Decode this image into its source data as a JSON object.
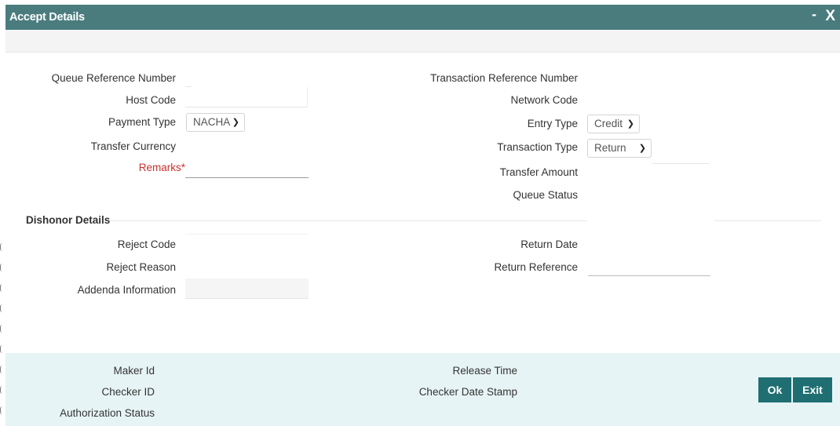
{
  "window": {
    "title": "Accept Details",
    "minimize": "-",
    "close": "X"
  },
  "form": {
    "queue_reference_number": {
      "label": "Queue Reference Number",
      "value": ""
    },
    "host_code": {
      "label": "Host Code",
      "value": ""
    },
    "payment_type": {
      "label": "Payment Type",
      "value": "NACHA"
    },
    "transfer_currency": {
      "label": "Transfer Currency",
      "value": ""
    },
    "remarks": {
      "label": "Remarks",
      "required_mark": "*",
      "value": ""
    },
    "transaction_reference_number": {
      "label": "Transaction Reference Number",
      "value": ""
    },
    "network_code": {
      "label": "Network Code",
      "value": ""
    },
    "entry_type": {
      "label": "Entry Type",
      "value": "Credit"
    },
    "transaction_type": {
      "label": "Transaction Type",
      "value": "Return"
    },
    "transfer_amount": {
      "label": "Transfer Amount",
      "value": ""
    },
    "queue_status": {
      "label": "Queue Status",
      "value": ""
    }
  },
  "dishonor": {
    "title": "Dishonor Details",
    "reject_code": {
      "label": "Reject Code",
      "value": ""
    },
    "reject_reason": {
      "label": "Reject Reason",
      "value": ""
    },
    "addenda_information": {
      "label": "Addenda Information",
      "value": ""
    },
    "return_date": {
      "label": "Return Date",
      "value": ""
    },
    "return_reference": {
      "label": "Return Reference",
      "value": ""
    }
  },
  "footer": {
    "maker_id": "Maker Id",
    "checker_id": "Checker ID",
    "authorization_status": "Authorization Status",
    "release_time": "Release Time",
    "checker_date_stamp": "Checker Date Stamp",
    "ok_label": "Ok",
    "exit_label": "Exit"
  }
}
